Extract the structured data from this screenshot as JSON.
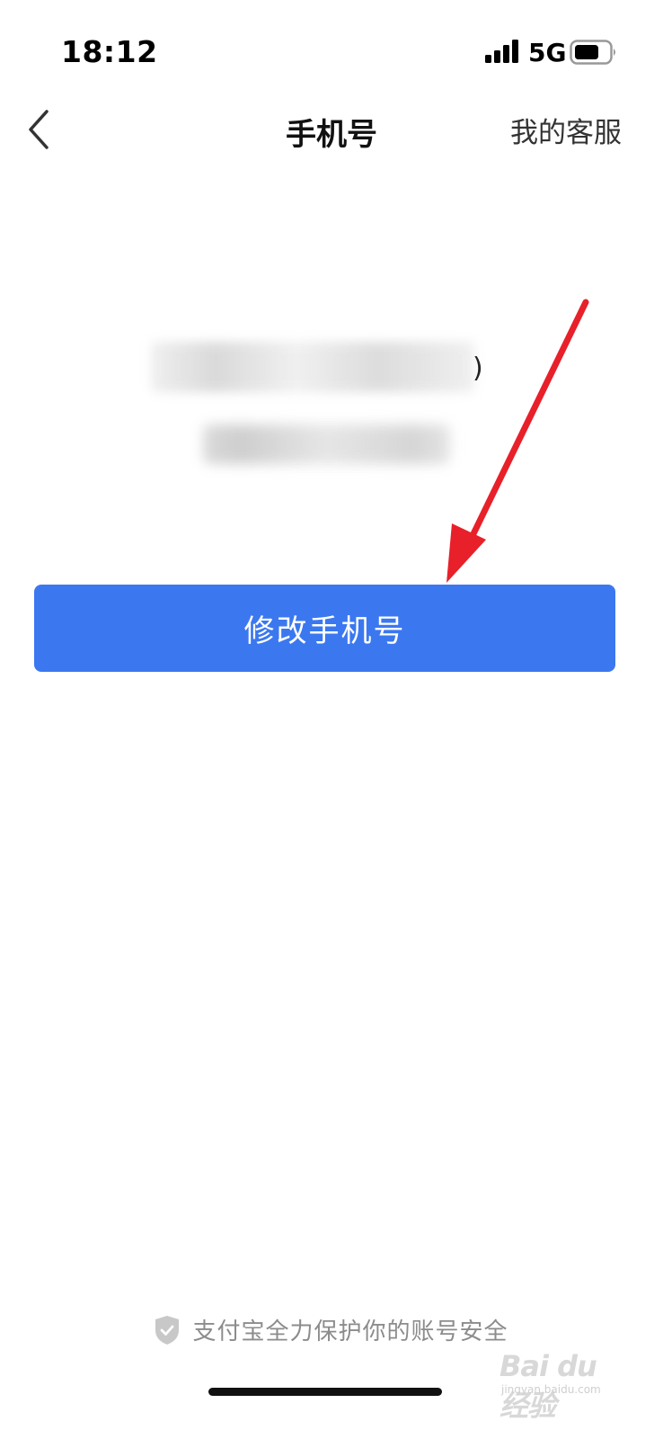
{
  "status_bar": {
    "time": "18:12",
    "network": "5G",
    "icons": [
      "signal-icon",
      "battery-icon"
    ]
  },
  "nav": {
    "back_icon": "chevron-left-icon",
    "title": "手机号",
    "support": "我的客服"
  },
  "masked": {
    "paren": ")"
  },
  "action": {
    "change_phone_label": "修改手机号"
  },
  "footer": {
    "shield_icon": "shield-check-icon",
    "security_text": "支付宝全力保护你的账号安全"
  },
  "watermark": {
    "logo": "Bai du经验",
    "url": "jingyan.baidu.com"
  },
  "colors": {
    "primary": "#3b78f0",
    "annotation": "#e8202a",
    "muted_text": "#8c8c8c"
  }
}
